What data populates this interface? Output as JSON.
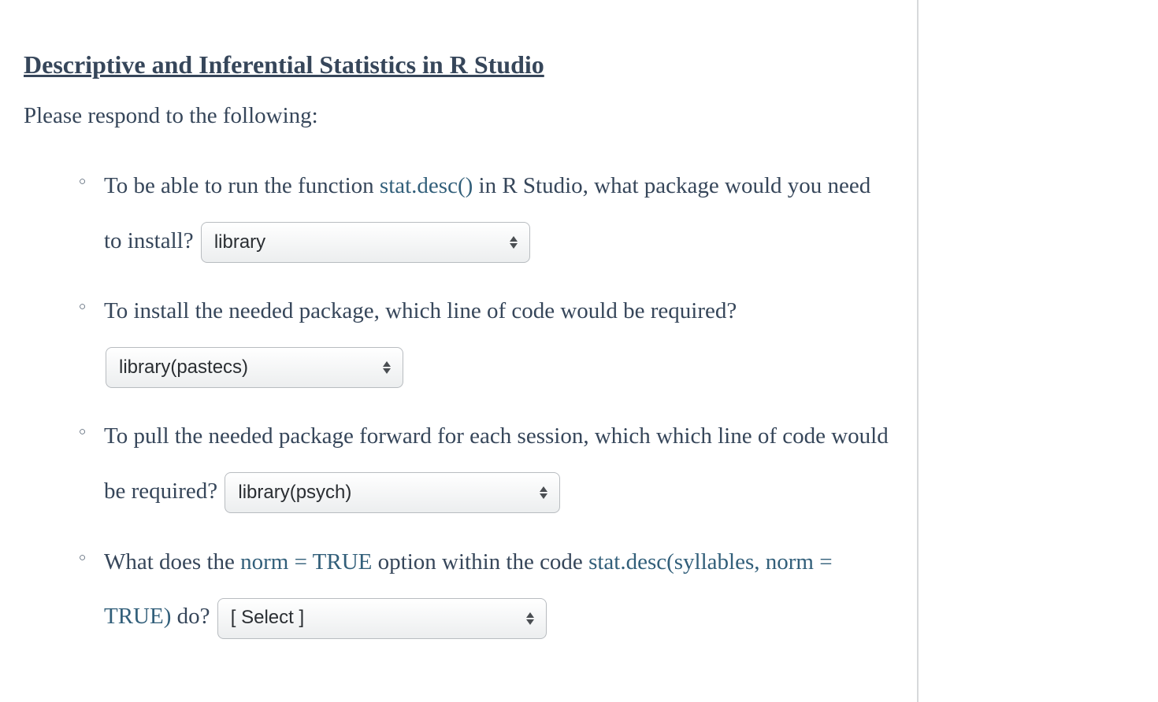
{
  "title": "Descriptive and Inferential Statistics in R Studio",
  "intro": "Please respond to the following:",
  "q1": {
    "text_a": "To be able to run the function ",
    "code": "stat.desc()",
    "text_b": " in R Studio, what package would you need to install? ",
    "select_value": "library"
  },
  "q2": {
    "text": "To install the needed package, which line of code would be required? ",
    "select_value": "library(pastecs)"
  },
  "q3": {
    "text_a": "To pull the needed package forward for each session, which which line of code would be required? ",
    "select_value": "library(psych)"
  },
  "q4": {
    "text_a": "What does the ",
    "code_a": "norm = TRUE",
    "text_b": " option within the code ",
    "code_b": "stat.desc(syllables, norm = TRUE)",
    "text_c": " do? ",
    "select_value": "[ Select ]"
  }
}
